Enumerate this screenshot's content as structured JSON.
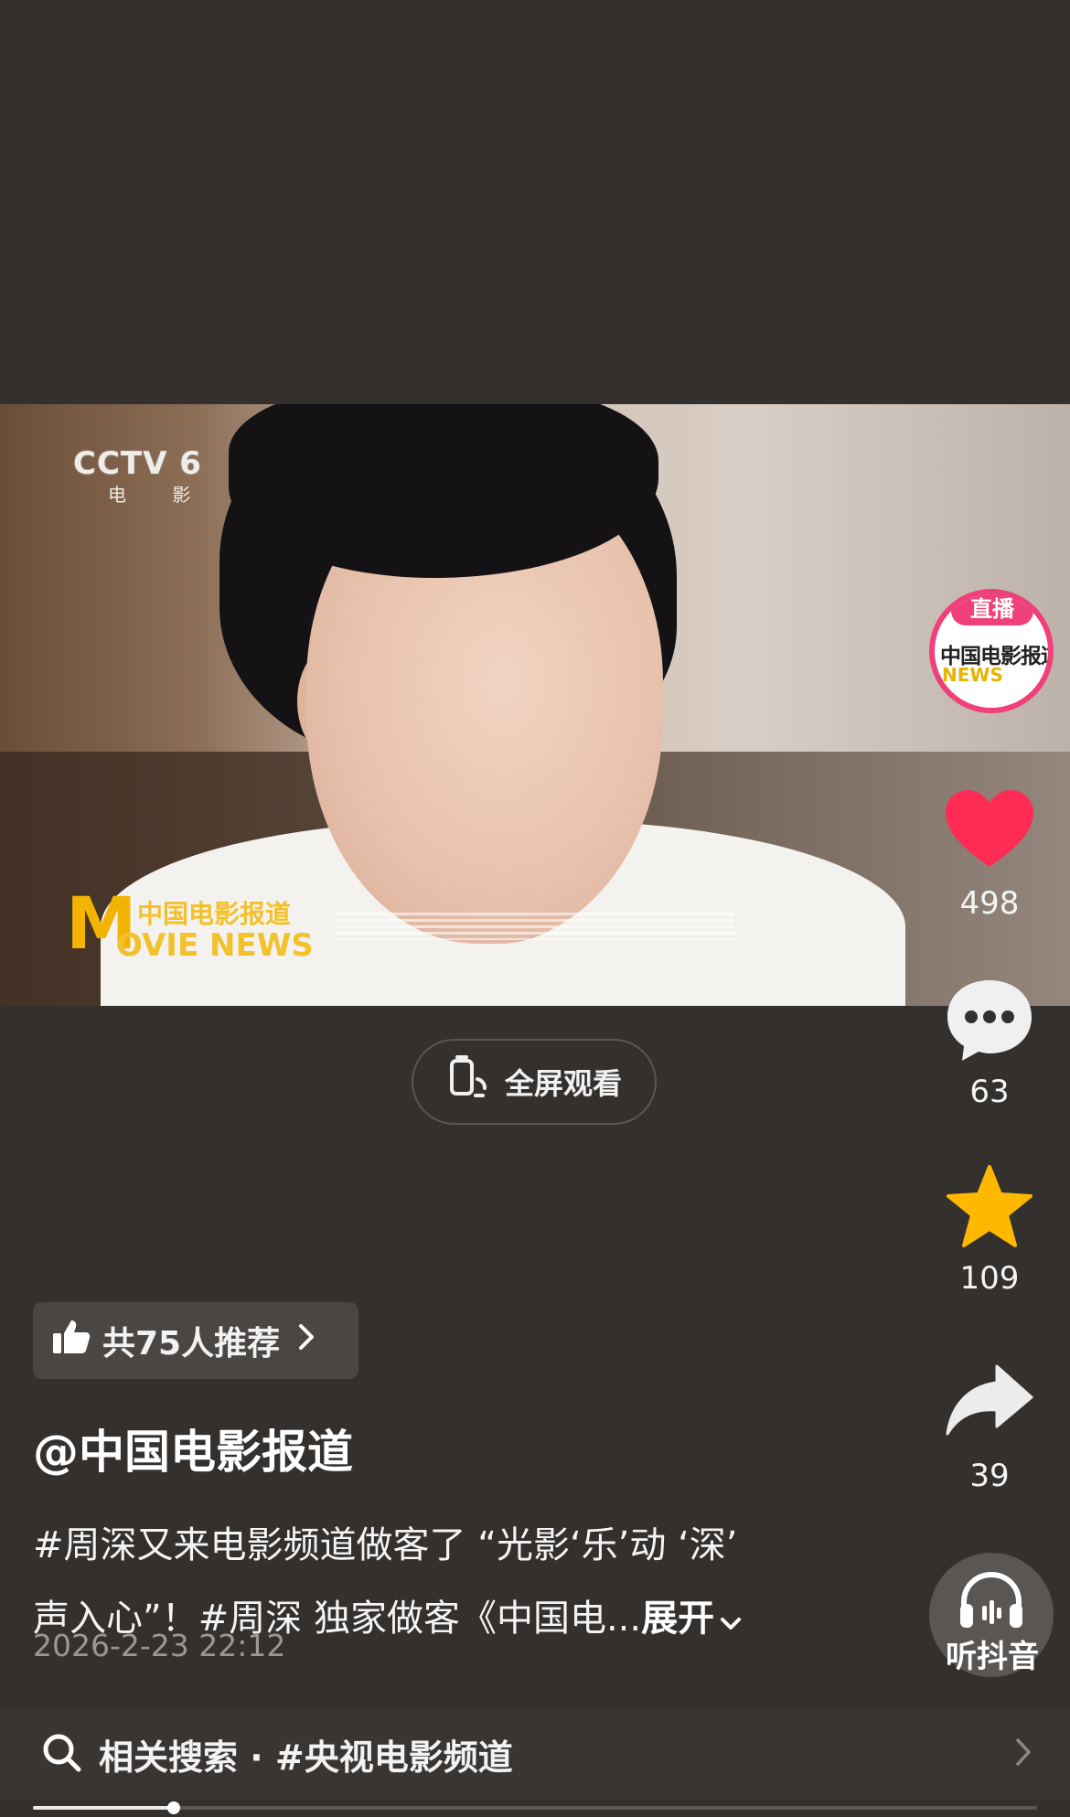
{
  "video": {
    "channel_logo": "CCTV 6",
    "channel_sub": "电 影",
    "program_logo_cn": "中国电影报道",
    "program_logo_en": "MOVIE NEWS"
  },
  "fullscreen": {
    "label": "全屏观看"
  },
  "actions": {
    "avatar_live_badge": "直播",
    "avatar_text": "中国电影报道",
    "avatar_text_en": "NEWS",
    "like_count": "498",
    "comment_count": "63",
    "favorite_count": "109",
    "share_count": "39",
    "listen_label": "听抖音"
  },
  "colors": {
    "like": "#fe2c55",
    "favorite": "#ffb800",
    "background": "#33302e",
    "live_ring": "#f0407a"
  },
  "recommend": {
    "label": "共75人推荐"
  },
  "post": {
    "author": "@中国电影报道",
    "description_line1": "#周深又来电影频道做客了 “光影‘乐’动 ‘深’",
    "description_line2": "声入心”！#周深 独家做客《中国电...",
    "expand_label": "展开",
    "timestamp": "2026-2-23 22:12"
  },
  "search": {
    "label": "相关搜索 · #央视电影频道"
  },
  "playback": {
    "progress": 0.14
  }
}
